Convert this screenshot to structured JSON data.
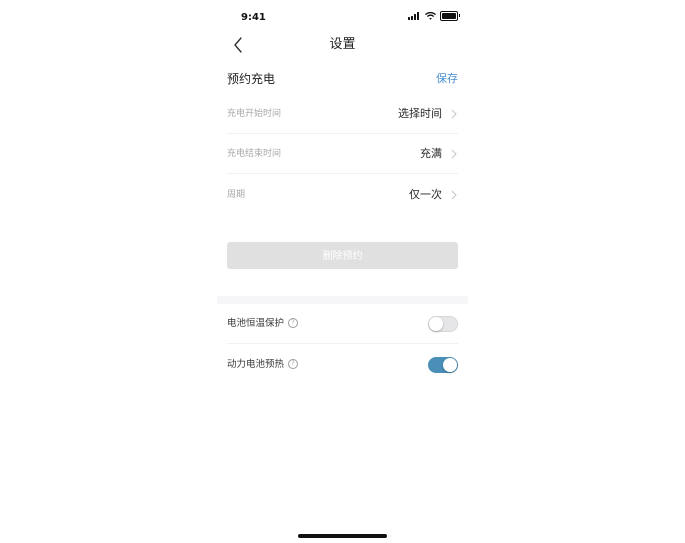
{
  "status_bar": {
    "time": "9:41",
    "icons": [
      "signal-icon",
      "wifi-icon",
      "battery-icon"
    ]
  },
  "nav": {
    "title": "设置",
    "back_icon": "chevron-left-icon"
  },
  "schedule": {
    "title": "预约充电",
    "save_label": "保存",
    "rows": [
      {
        "label": "充电开始时间",
        "value": "选择时间"
      },
      {
        "label": "充电结束时间",
        "value": "充满"
      },
      {
        "label": "周期",
        "value": "仅一次"
      }
    ],
    "delete_label": "删除预约"
  },
  "toggles": [
    {
      "label": "电池恒温保护",
      "on": false
    },
    {
      "label": "动力电池预热",
      "on": true
    }
  ],
  "help_icon_glyph": "?",
  "colors": {
    "accent": "#4a8fd0",
    "toggle_on": "#4a8fb8",
    "disabled_button": "#e0e0e0"
  }
}
